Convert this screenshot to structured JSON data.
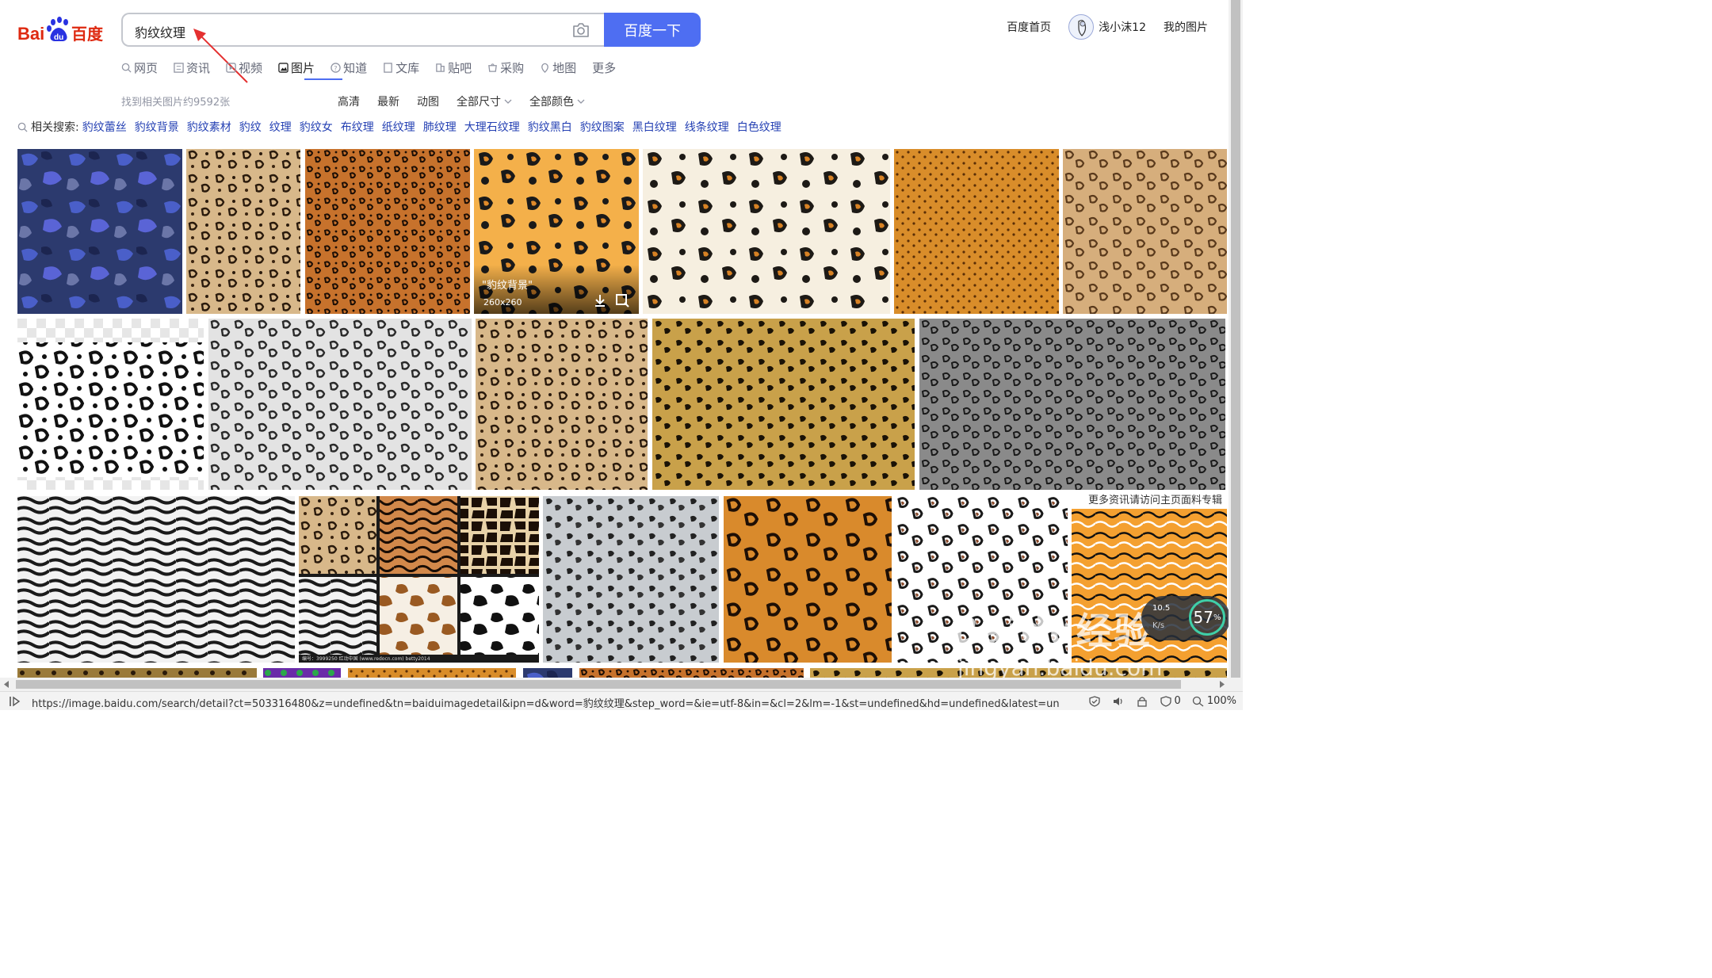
{
  "header": {
    "logo_text": "Bai百度",
    "search_value": "豹纹纹理",
    "search_button": "百度一下",
    "links": {
      "home": "百度首页",
      "username": "浅小沫12",
      "my_images": "我的图片"
    }
  },
  "nav": {
    "items": [
      {
        "label": "网页",
        "icon": "search-icon"
      },
      {
        "label": "资讯",
        "icon": "news-icon"
      },
      {
        "label": "视频",
        "icon": "video-icon"
      },
      {
        "label": "图片",
        "icon": "image-icon",
        "active": true
      },
      {
        "label": "知道",
        "icon": "question-icon"
      },
      {
        "label": "文库",
        "icon": "doc-icon"
      },
      {
        "label": "贴吧",
        "icon": "tieba-icon"
      },
      {
        "label": "采购",
        "icon": "cart-icon"
      },
      {
        "label": "地图",
        "icon": "map-icon"
      },
      {
        "label": "更多",
        "icon": ""
      }
    ]
  },
  "results": {
    "count_text": "找到相关图片约9592张",
    "filters": [
      "高清",
      "最新",
      "动图",
      "全部尺寸",
      "全部颜色"
    ]
  },
  "related": {
    "label": "相关搜索:",
    "tags": [
      "豹纹蕾丝",
      "豹纹背景",
      "豹纹素材",
      "豹纹",
      "纹理",
      "豹纹女",
      "布纹理",
      "纸纹理",
      "肺纹理",
      "大理石纹理",
      "豹纹黑白",
      "豹纹图案",
      "黑白纹理",
      "线条纹理",
      "白色纹理"
    ]
  },
  "hover_card": {
    "title": "\"豹纹背景\"",
    "size": "260x260"
  },
  "caption_more": "更多资讯请访问主页面料专辑",
  "collage_footer": "编号：3999250   红动中国 (www.redocn.com)   betty2014",
  "speed_widget": {
    "up": "10.5",
    "down": "K/s",
    "percent": "57",
    "unit": "%"
  },
  "watermark": {
    "main": "Baidu经验",
    "url": "jingyan.baidu.com"
  },
  "status_bar": {
    "url": "https://image.baidu.com/search/detail?ct=503316480&z=undefined&tn=baiduimagedetail&ipn=d&word=豹纹纹理&step_word=&ie=utf-8&in=&cl=2&lm=-1&st=undefined&hd=undefined&latest=unde.",
    "blocked": "0",
    "zoom": "100%"
  },
  "colors": {
    "accent": "#4e6ef2",
    "link": "#2440b3",
    "logo_red": "#de2910",
    "logo_blue": "#2932e1"
  }
}
